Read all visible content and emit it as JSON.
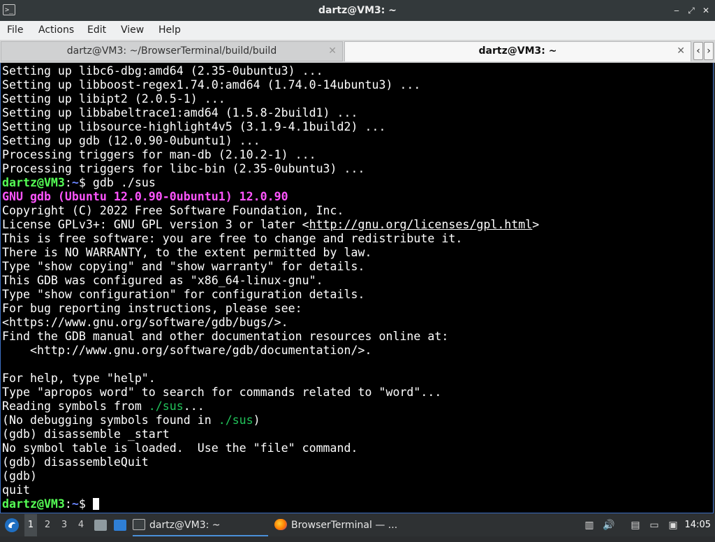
{
  "window": {
    "title": "dartz@VM3: ~",
    "minimize_glyph": "‒",
    "maximize_glyph": "⤢",
    "close_glyph": "✕"
  },
  "menu": [
    "File",
    "Actions",
    "Edit",
    "View",
    "Help"
  ],
  "tabs": [
    {
      "label": "dartz@VM3: ~/BrowserTerminal/build/build",
      "active": false
    },
    {
      "label": "dartz@VM3: ~",
      "active": true
    }
  ],
  "tab_close_glyph": "✕",
  "tab_scroll": {
    "left": "‹",
    "right": "›"
  },
  "terminal": {
    "lines": [
      "Setting up libc6-dbg:amd64 (2.35-0ubuntu3) ...",
      "Setting up libboost-regex1.74.0:amd64 (1.74.0-14ubuntu3) ...",
      "Setting up libipt2 (2.0.5-1) ...",
      "Setting up libbabeltrace1:amd64 (1.5.8-2build1) ...",
      "Setting up libsource-highlight4v5 (3.1.9-4.1build2) ...",
      "Setting up gdb (12.0.90-0ubuntu1) ...",
      "Processing triggers for man-db (2.10.2-1) ...",
      "Processing triggers for libc-bin (2.35-0ubuntu3) ...",
      {
        "prompt_user": "dartz@VM3",
        "prompt_sep": ":",
        "prompt_path": "~",
        "prompt_end": "$ ",
        "cmd": "gdb ./sus"
      },
      {
        "gdb_version": "GNU gdb (Ubuntu 12.0.90-0ubuntu1) 12.0.90"
      },
      "Copyright (C) 2022 Free Software Foundation, Inc.",
      {
        "pre": "License GPLv3+: GNU GPL version 3 or later <",
        "link": "http://gnu.org/licenses/gpl.html",
        "post": ">"
      },
      "This is free software: you are free to change and redistribute it.",
      "There is NO WARRANTY, to the extent permitted by law.",
      "Type \"show copying\" and \"show warranty\" for details.",
      "This GDB was configured as \"x86_64-linux-gnu\".",
      "Type \"show configuration\" for configuration details.",
      "For bug reporting instructions, please see:",
      "<https://www.gnu.org/software/gdb/bugs/>.",
      "Find the GDB manual and other documentation resources online at:",
      "    <http://www.gnu.org/software/gdb/documentation/>.",
      "",
      "For help, type \"help\".",
      "Type \"apropos word\" to search for commands related to \"word\"...",
      {
        "pre": "Reading symbols from ",
        "path": "./sus",
        "post": "..."
      },
      {
        "pre": "(No debugging symbols found in ",
        "path": "./sus",
        "post": ")"
      },
      "(gdb) disassemble _start",
      "No symbol table is loaded.  Use the \"file\" command.",
      "(gdb) disassembleQuit",
      "(gdb)",
      "quit",
      {
        "prompt_user": "dartz@VM3",
        "prompt_sep": ":",
        "prompt_path": "~",
        "prompt_end": "$ ",
        "cmd": "",
        "cursor": true
      }
    ]
  },
  "taskbar": {
    "workspaces": [
      "1",
      "2",
      "3",
      "4"
    ],
    "active_workspace": "1",
    "tasks": [
      {
        "label": "dartz@VM3: ~",
        "icon": "terminal-icon",
        "active": true
      },
      {
        "label": "BrowserTerminal — ...",
        "icon": "firefox-icon",
        "active": false
      }
    ],
    "clock": "14:05"
  },
  "colors": {
    "prompt": "#55ff55",
    "path_tilde": "#6b86ff",
    "gdb_version": "#ff55ff",
    "file_path": "#22c35a",
    "terminal_bg": "#000000"
  }
}
